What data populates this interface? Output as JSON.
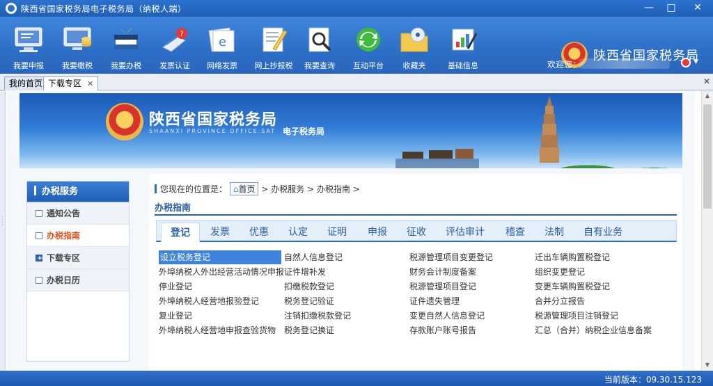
{
  "window": {
    "title": "陕西省国家税务局电子税务局（纳税人端）",
    "controls": {
      "minimize": "—",
      "maximize": "□",
      "close": "✕"
    }
  },
  "toolbar": {
    "items": [
      {
        "label": "我要申报",
        "icon": "monitor-report-icon"
      },
      {
        "label": "我要缴税",
        "icon": "monitor-coins-icon"
      },
      {
        "label": "我要办税",
        "icon": "books-plant-icon"
      },
      {
        "label": "发票认证",
        "icon": "invoice-verify-icon"
      },
      {
        "label": "网络发票",
        "icon": "online-invoice-icon"
      },
      {
        "label": "网上抄报税",
        "icon": "notepad-pencil-icon"
      },
      {
        "label": "我要查询",
        "icon": "magnifier-icon"
      },
      {
        "label": "互动平台",
        "icon": "refresh-arrows-icon"
      },
      {
        "label": "收藏夹",
        "icon": "folder-disc-icon"
      },
      {
        "label": "基础信息",
        "icon": "chart-board-icon"
      }
    ],
    "brand": "陕西省国家税务局",
    "welcome": "欢迎您："
  },
  "tabs": {
    "items": [
      {
        "label": "我的首页"
      },
      {
        "label": "下载专区"
      }
    ],
    "tab_close": "✕",
    "strip_close": "✕"
  },
  "banner": {
    "title": "陕西省国家税务局",
    "subtitle": "SHAANXI PROVINCE OFFICE.SAT",
    "tag": "电子税务局"
  },
  "sidebar": {
    "header": "办税服务",
    "items": [
      {
        "label": "通知公告"
      },
      {
        "label": "办税指南"
      },
      {
        "label": "下载专区"
      },
      {
        "label": "办税日历"
      }
    ]
  },
  "breadcrumb": {
    "prefix": "您现在的位置是：",
    "home": "首页",
    "items": [
      "办税服务",
      "办税指南"
    ],
    "sep": ">"
  },
  "section": {
    "title": "办税指南"
  },
  "guide_tabs": [
    "登记",
    "发票",
    "优惠",
    "认定",
    "证明",
    "申报",
    "征收",
    "评估审计",
    "稽查",
    "法制",
    "自有业务"
  ],
  "guide_items": [
    [
      "设立税务登记",
      "自然人信息登记",
      "税源管理项目变更登记",
      "迁出车辆购置税登记"
    ],
    [
      "外埠纳税人外出经营活动情况申报",
      "证件增补发",
      "财务会计制度备案",
      "组织变更登记"
    ],
    [
      "停业登记",
      "扣缴税款登记",
      "税源管理项目登记",
      "变更车辆购置税登记"
    ],
    [
      "外埠纳税人经营地报验登记",
      "税务登记验证",
      "证件遗失管理",
      "合并分立报告"
    ],
    [
      "复业登记",
      "注销扣缴税款登记",
      "变更自然人信息登记",
      "税源管理项目注销登记"
    ],
    [
      "外埠纳税人经营地申报查验货物",
      "税务登记换证",
      "存款账户账号报告",
      "汇总（合并）纳税企业信息备案"
    ]
  ],
  "status": {
    "version": "当前版本：09.30.15.123"
  }
}
